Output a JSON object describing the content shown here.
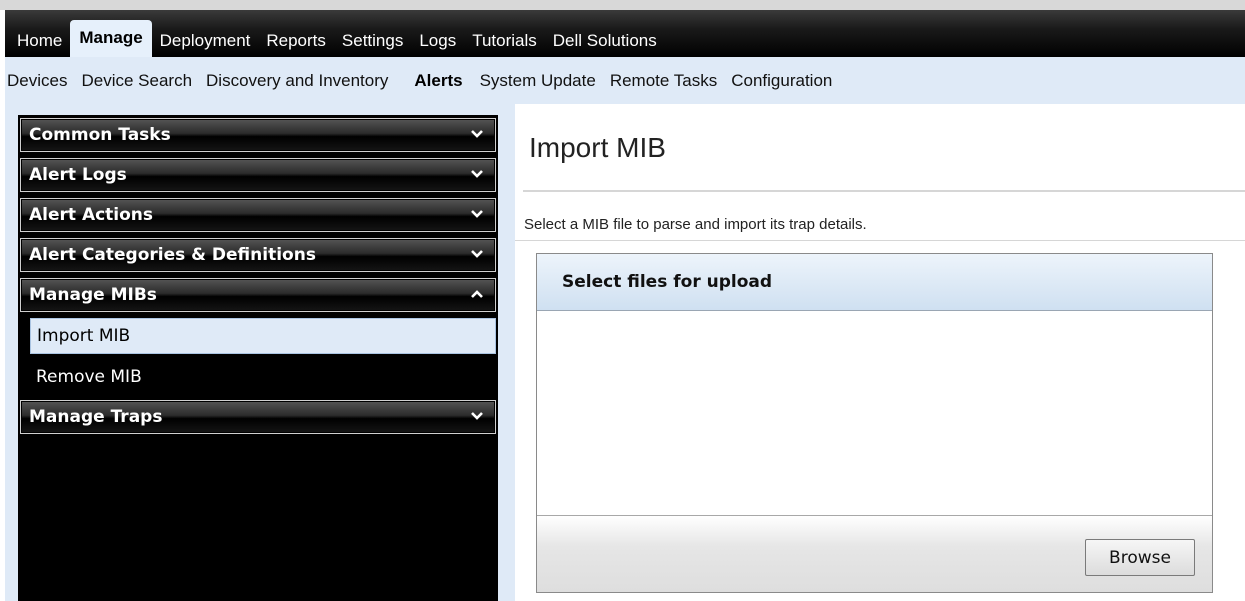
{
  "main_nav": {
    "tabs": [
      "Home",
      "Manage",
      "Deployment",
      "Reports",
      "Settings",
      "Logs",
      "Tutorials",
      "Dell Solutions"
    ],
    "active": "Manage"
  },
  "sub_nav": {
    "tabs": [
      "Devices",
      "Device Search",
      "Discovery and Inventory",
      "Alerts",
      "System Update",
      "Remote Tasks",
      "Configuration"
    ],
    "active": "Alerts"
  },
  "sidebar": {
    "sections": [
      {
        "label": "Common Tasks",
        "expanded": false
      },
      {
        "label": "Alert Logs",
        "expanded": false
      },
      {
        "label": "Alert Actions",
        "expanded": false
      },
      {
        "label": "Alert Categories & Definitions",
        "expanded": false
      },
      {
        "label": "Manage MIBs",
        "expanded": true,
        "items": [
          "Import MIB",
          "Remove MIB"
        ],
        "selected": "Import MIB"
      },
      {
        "label": "Manage Traps",
        "expanded": false
      }
    ]
  },
  "content": {
    "title": "Import MIB",
    "description": "Select a MIB file to parse and import its trap details.",
    "upload_panel": {
      "header": "Select files for upload",
      "browse_label": "Browse"
    }
  },
  "colors": {
    "nav_black": "#000000",
    "light_blue": "#dfeaf7",
    "active_tab": "#e6f0fb"
  }
}
